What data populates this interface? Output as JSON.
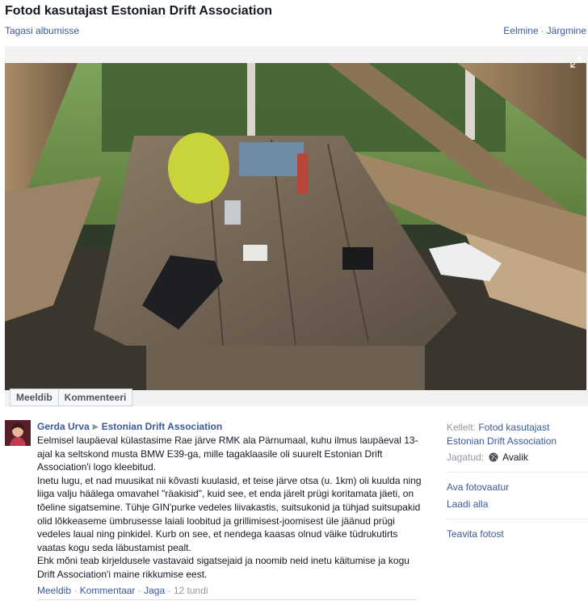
{
  "header": {
    "title": "Fotod kasutajast Estonian Drift Association",
    "back_link": "Tagasi albumisse",
    "prev": "Eelmine",
    "separator": "·",
    "next": "Järgmine"
  },
  "photo_actions": {
    "like": "Meeldib",
    "comment": "Kommenteeri"
  },
  "post": {
    "author": "Gerda Urva",
    "target": "Estonian Drift Association",
    "paragraphs": [
      "Eelmisel laupäeval külastasime Rae järve RMK ala Pärnumaal, kuhu ilmus laupäeval 13-ajal ka seltskond musta BMW E39-ga, mille tagaklaasile oli suurelt Estonian Drift Association'i logo kleebitud.",
      "Inetu lugu, et nad muusikat nii kõvasti kuulasid, et teise järve otsa (u. 1km) oli kuulda ning liiga valju häälega omavahel \"räakisid\", kuid see, et enda järelt prügi koritamata jäeti, on tõeline sigatsemine. Tühje GIN'purke vedeles liivakastis, suitsukonid ja tühjad suitsupakid olid lõkkeaseme ümbrusesse laiali loobitud ja grillimisest-joomisest üle jäänud prügi vedeles laual ning pinkidel. Kurb on see, et nendega kaasas olnud väike tüdrukutirts vaatas kogu seda läbustamist pealt.",
      "Ehk mõni teab kirjeldusele vastavaid sigatsejaid ja noomib neid inetu käitumise ja kogu Drift Association'i maine rikkumise eest."
    ],
    "meta": {
      "like": "Meeldib",
      "comment": "Kommentaar",
      "share": "Jaga",
      "time": "12 tundi",
      "sep": "·"
    }
  },
  "sidebar": {
    "from_label": "Kellelt:",
    "from_value": "Fotod kasutajast Estonian Drift Association",
    "shared_label": "Jagatud:",
    "shared_value": "Avalik",
    "actions": [
      "Ava fotovaatur",
      "Laadi alla"
    ],
    "report": "Teavita fotost"
  },
  "colors": {
    "link": "#3b5998",
    "muted": "#9197a3"
  }
}
